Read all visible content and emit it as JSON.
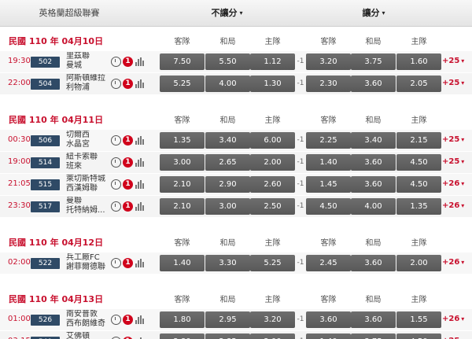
{
  "header": {
    "league": "英格蘭超級聯賽",
    "market1": "不讓分",
    "market2": "讓分",
    "caret": "▾"
  },
  "columns": [
    "客隊",
    "和局",
    "主隊"
  ],
  "icons": {
    "alert_text": "1",
    "more_caret": "▾"
  },
  "sections": [
    {
      "date": "民國 110 年 04月10日",
      "matches": [
        {
          "time": "19:30",
          "num": "502",
          "teams": [
            "里茲聯",
            "曼城"
          ],
          "odds": [
            "7.50",
            "5.50",
            "1.12"
          ],
          "hcp": "-1",
          "hodds": [
            "3.20",
            "3.75",
            "1.60"
          ],
          "more": "+25"
        },
        {
          "time": "22:00",
          "num": "504",
          "teams": [
            "阿斯頓維拉",
            "利物浦"
          ],
          "odds": [
            "5.25",
            "4.00",
            "1.30"
          ],
          "hcp": "-1",
          "hodds": [
            "2.30",
            "3.60",
            "2.05"
          ],
          "more": "+25"
        }
      ]
    },
    {
      "date": "民國 110 年 04月11日",
      "matches": [
        {
          "time": "00:30",
          "num": "506",
          "teams": [
            "切爾西",
            "水晶宮"
          ],
          "odds": [
            "1.35",
            "3.40",
            "6.00"
          ],
          "hcp": "-1",
          "hodds": [
            "2.25",
            "3.40",
            "2.15"
          ],
          "more": "+25"
        },
        {
          "time": "19:00",
          "num": "514",
          "teams": [
            "紐卡索聯",
            "班來"
          ],
          "odds": [
            "3.00",
            "2.65",
            "2.00"
          ],
          "hcp": "-1",
          "hodds": [
            "1.40",
            "3.60",
            "4.50"
          ],
          "more": "+25"
        },
        {
          "time": "21:05",
          "num": "515",
          "teams": [
            "萊切斯特城",
            "西漢姆聯"
          ],
          "odds": [
            "2.10",
            "2.90",
            "2.60"
          ],
          "hcp": "-1",
          "hodds": [
            "1.45",
            "3.60",
            "4.50"
          ],
          "more": "+26"
        },
        {
          "time": "23:30",
          "num": "517",
          "teams": [
            "曼聯",
            "托特納姆..."
          ],
          "odds": [
            "2.10",
            "3.00",
            "2.50"
          ],
          "hcp": "-1",
          "hodds": [
            "4.50",
            "4.00",
            "1.35"
          ],
          "more": "+26"
        }
      ]
    },
    {
      "date": "民國 110 年 04月12日",
      "matches": [
        {
          "time": "02:00",
          "num": "522",
          "teams": [
            "兵工廠FC",
            "謝菲爾德聯"
          ],
          "odds": [
            "1.40",
            "3.30",
            "5.25"
          ],
          "hcp": "-1",
          "hodds": [
            "2.45",
            "3.60",
            "2.00"
          ],
          "more": "+26"
        }
      ]
    },
    {
      "date": "民國 110 年 04月13日",
      "matches": [
        {
          "time": "01:00",
          "num": "526",
          "teams": [
            "南安普敦",
            "西布朗維奇"
          ],
          "odds": [
            "1.80",
            "2.95",
            "3.20"
          ],
          "hcp": "-1",
          "hodds": [
            "3.60",
            "3.60",
            "1.55"
          ],
          "more": "+26"
        },
        {
          "time": "03:15",
          "num": "540",
          "teams": [
            "艾佛頓",
            "布萊頓"
          ],
          "odds": [
            "2.80",
            "2.85",
            "2.00"
          ],
          "hcp": "-1",
          "hodds": [
            "1.40",
            "3.75",
            "4.50"
          ],
          "more": "+25"
        }
      ]
    }
  ]
}
